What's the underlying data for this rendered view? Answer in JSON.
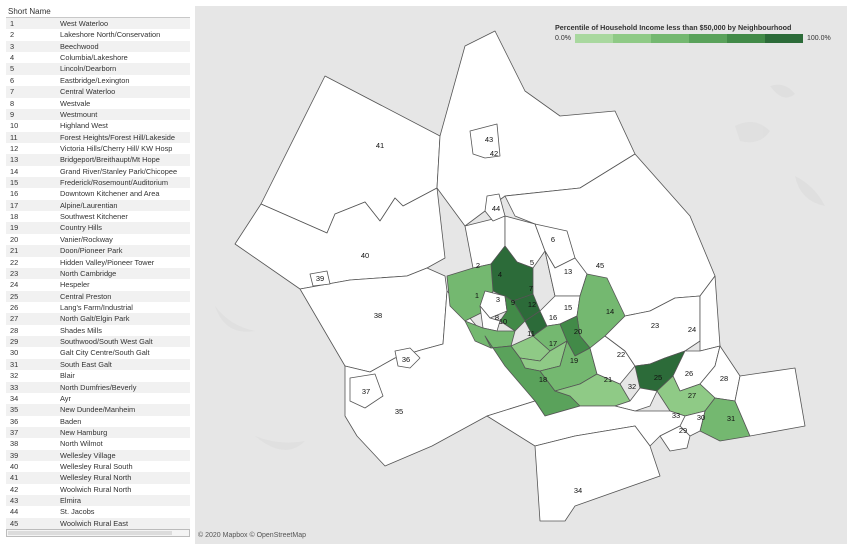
{
  "legend_panel": {
    "header": "Short Name",
    "rows": [
      {
        "num": "1",
        "name": "West Waterloo"
      },
      {
        "num": "2",
        "name": "Lakeshore North/Conservation"
      },
      {
        "num": "3",
        "name": "Beechwood"
      },
      {
        "num": "4",
        "name": "Columbia/Lakeshore"
      },
      {
        "num": "5",
        "name": "Lincoln/Dearborn"
      },
      {
        "num": "6",
        "name": "Eastbridge/Lexington"
      },
      {
        "num": "7",
        "name": "Central Waterloo"
      },
      {
        "num": "8",
        "name": "Westvale"
      },
      {
        "num": "9",
        "name": "Westmount"
      },
      {
        "num": "10",
        "name": "Highland West"
      },
      {
        "num": "11",
        "name": "Forest Heights/Forest Hill/Lakeside"
      },
      {
        "num": "12",
        "name": "Victoria Hills/Cherry Hill/ KW Hosp"
      },
      {
        "num": "13",
        "name": "Bridgeport/Breithaupt/Mt Hope"
      },
      {
        "num": "14",
        "name": "Grand River/Stanley Park/Chicopee"
      },
      {
        "num": "15",
        "name": "Frederick/Rosemount/Auditorium"
      },
      {
        "num": "16",
        "name": "Downtown Kitchener and Area"
      },
      {
        "num": "17",
        "name": "Alpine/Laurentian"
      },
      {
        "num": "18",
        "name": "Southwest Kitchener"
      },
      {
        "num": "19",
        "name": "Country Hills"
      },
      {
        "num": "20",
        "name": "Vanier/Rockway"
      },
      {
        "num": "21",
        "name": "Doon/Pioneer Park"
      },
      {
        "num": "22",
        "name": "Hidden Valley/Pioneer Tower"
      },
      {
        "num": "23",
        "name": "North Cambridge"
      },
      {
        "num": "24",
        "name": "Hespeler"
      },
      {
        "num": "25",
        "name": "Central Preston"
      },
      {
        "num": "26",
        "name": "Lang's Farm/Industrial"
      },
      {
        "num": "27",
        "name": "North Galt/Elgin Park"
      },
      {
        "num": "28",
        "name": "Shades Mills"
      },
      {
        "num": "29",
        "name": "Southwood/South West Galt"
      },
      {
        "num": "30",
        "name": "Galt City Centre/South Galt"
      },
      {
        "num": "31",
        "name": "South East Galt"
      },
      {
        "num": "32",
        "name": "Blair"
      },
      {
        "num": "33",
        "name": "North Dumfries/Beverly"
      },
      {
        "num": "34",
        "name": "Ayr"
      },
      {
        "num": "35",
        "name": "New Dundee/Manheim"
      },
      {
        "num": "36",
        "name": "Baden"
      },
      {
        "num": "37",
        "name": "New Hamburg"
      },
      {
        "num": "38",
        "name": "North Wilmot"
      },
      {
        "num": "39",
        "name": "Wellesley Village"
      },
      {
        "num": "40",
        "name": "Wellesley Rural South"
      },
      {
        "num": "41",
        "name": "Wellesley Rural North"
      },
      {
        "num": "42",
        "name": "Woolwich Rural North"
      },
      {
        "num": "43",
        "name": "Elmira"
      },
      {
        "num": "44",
        "name": "St. Jacobs"
      },
      {
        "num": "45",
        "name": "Woolwich Rural East"
      }
    ]
  },
  "color_legend": {
    "title": "Percentile of Household Income less than $50,000 by Neighbourhood",
    "min_label": "0.0%",
    "max_label": "100.0%",
    "colors": [
      "#a9d89f",
      "#8fca86",
      "#74b870",
      "#5aa25b",
      "#428a48",
      "#2c6b39"
    ]
  },
  "map": {
    "attribution": "© 2020 Mapbox © OpenStreetMap",
    "regions": [
      {
        "id": "1",
        "percentile_shade": 2
      },
      {
        "id": "2",
        "percentile_shade": 0
      },
      {
        "id": "3",
        "percentile_shade": 0
      },
      {
        "id": "4",
        "percentile_shade": 5
      },
      {
        "id": "5",
        "percentile_shade": 0
      },
      {
        "id": "6",
        "percentile_shade": 0
      },
      {
        "id": "7",
        "percentile_shade": 5
      },
      {
        "id": "8",
        "percentile_shade": 0
      },
      {
        "id": "9",
        "percentile_shade": 4
      },
      {
        "id": "10",
        "percentile_shade": 2
      },
      {
        "id": "11",
        "percentile_shade": 1
      },
      {
        "id": "12",
        "percentile_shade": 5
      },
      {
        "id": "13",
        "percentile_shade": 0
      },
      {
        "id": "14",
        "percentile_shade": 2
      },
      {
        "id": "15",
        "percentile_shade": 0
      },
      {
        "id": "16",
        "percentile_shade": 2
      },
      {
        "id": "17",
        "percentile_shade": 1
      },
      {
        "id": "18",
        "percentile_shade": 3
      },
      {
        "id": "19",
        "percentile_shade": 2
      },
      {
        "id": "20",
        "percentile_shade": 4
      },
      {
        "id": "21",
        "percentile_shade": 1
      },
      {
        "id": "22",
        "percentile_shade": 0
      },
      {
        "id": "23",
        "percentile_shade": 0
      },
      {
        "id": "24",
        "percentile_shade": 0
      },
      {
        "id": "25",
        "percentile_shade": 5
      },
      {
        "id": "26",
        "percentile_shade": 0
      },
      {
        "id": "27",
        "percentile_shade": 1
      },
      {
        "id": "28",
        "percentile_shade": 0
      },
      {
        "id": "29",
        "percentile_shade": 0
      },
      {
        "id": "30",
        "percentile_shade": 0
      },
      {
        "id": "31",
        "percentile_shade": 2
      },
      {
        "id": "32",
        "percentile_shade": 0
      },
      {
        "id": "33",
        "percentile_shade": 0
      },
      {
        "id": "34",
        "percentile_shade": 0
      },
      {
        "id": "35",
        "percentile_shade": 0
      },
      {
        "id": "36",
        "percentile_shade": 0
      },
      {
        "id": "37",
        "percentile_shade": 0
      },
      {
        "id": "38",
        "percentile_shade": 0
      },
      {
        "id": "39",
        "percentile_shade": 0
      },
      {
        "id": "40",
        "percentile_shade": 0
      },
      {
        "id": "41",
        "percentile_shade": 0
      },
      {
        "id": "42",
        "percentile_shade": 0
      },
      {
        "id": "43",
        "percentile_shade": 0
      },
      {
        "id": "44",
        "percentile_shade": 0
      },
      {
        "id": "45",
        "percentile_shade": 0
      }
    ]
  }
}
